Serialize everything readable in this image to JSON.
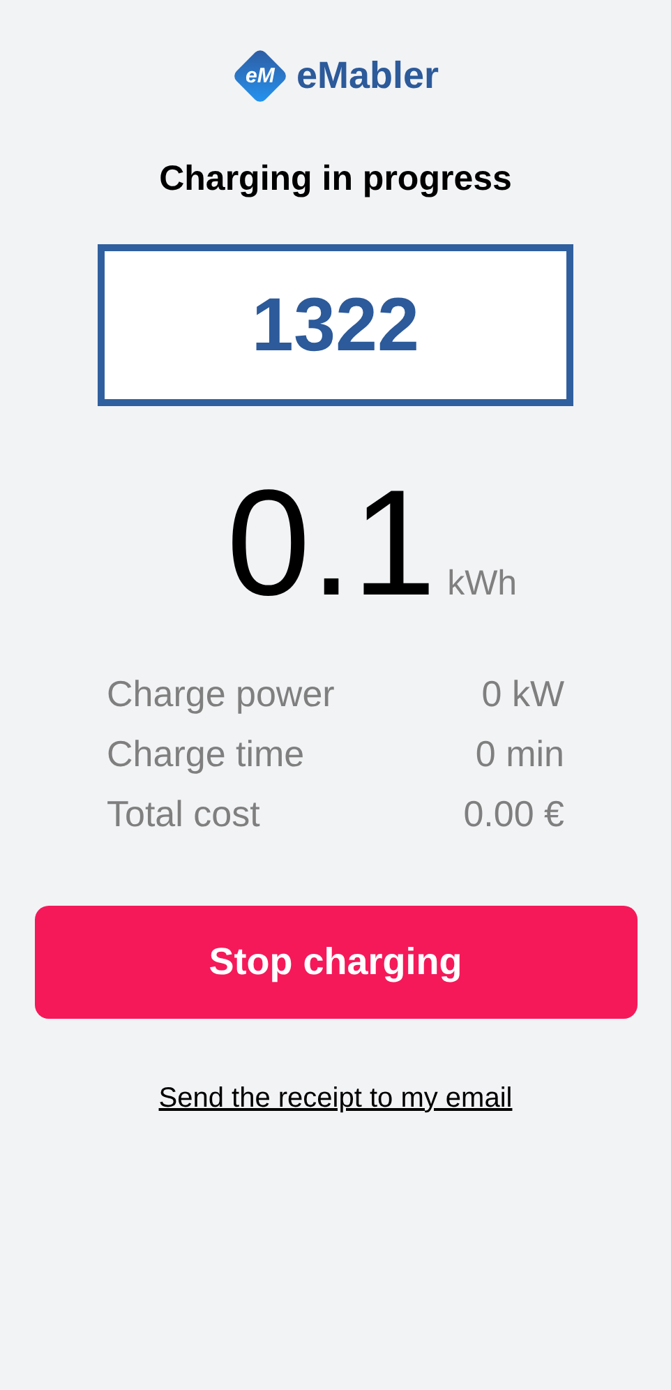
{
  "logo": {
    "mark": "eM",
    "name": "eMabler"
  },
  "title": "Charging in progress",
  "code": "1322",
  "energy": {
    "value": "0.1",
    "unit": "kWh"
  },
  "stats": [
    {
      "label": "Charge power",
      "value": "0 kW"
    },
    {
      "label": "Charge time",
      "value": "0 min"
    },
    {
      "label": "Total cost",
      "value": "0.00 €"
    }
  ],
  "button": "Stop charging",
  "link": "Send the receipt to my email"
}
